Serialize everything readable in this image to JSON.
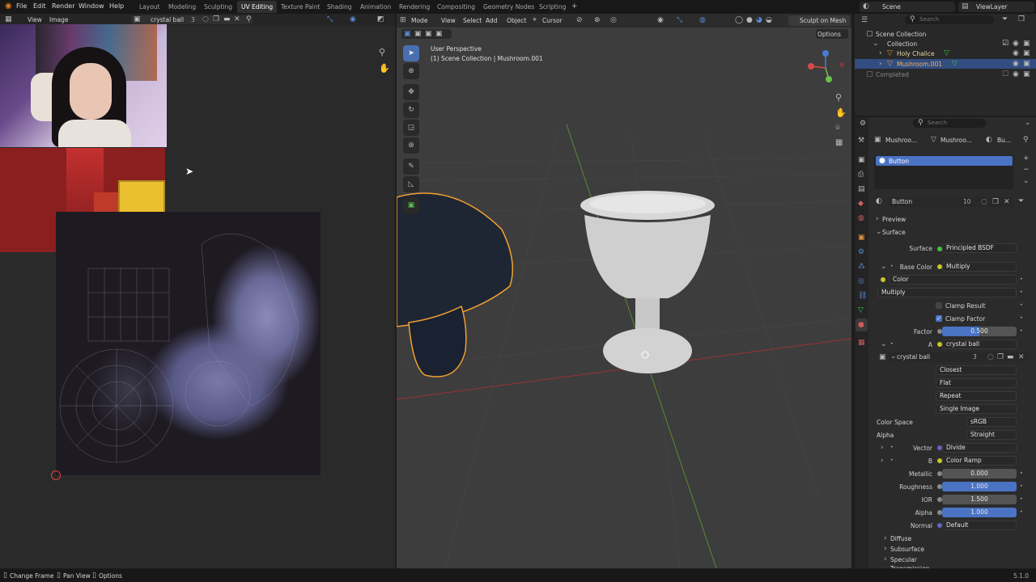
{
  "menubar": {
    "items": [
      "File",
      "Edit",
      "Render",
      "Window",
      "Help"
    ],
    "workspaces": [
      "Layout",
      "Modeling",
      "Sculpting",
      "UV Editing",
      "Texture Paint",
      "Shading",
      "Animation",
      "Rendering",
      "Compositing",
      "Geometry Nodes",
      "Scripting"
    ],
    "active_workspace": "UV Editing",
    "scene": "Scene",
    "view_layer": "ViewLayer"
  },
  "uv_editor": {
    "menu": [
      "View",
      "Image"
    ],
    "image_name": "crystal ball",
    "image_users": "3"
  },
  "viewport": {
    "mode": "Mode",
    "menus": [
      "View",
      "Select",
      "Add",
      "Object"
    ],
    "transform_orient": "Cursor",
    "sculpt_btn": "Sculpt on Mesh",
    "options": "Options",
    "view_name": "User Perspective",
    "collection_path": "(1) Scene Collection | Mushroom.001"
  },
  "outliner": {
    "search_placeholder": "Search",
    "root": "Scene Collection",
    "collection": "Collection",
    "items": [
      "Holy Chalice",
      "Mushroom.001"
    ],
    "completed": "Completed"
  },
  "properties": {
    "search_placeholder": "Search",
    "breadcrumb": [
      "Mushroo...",
      "Mushroo...",
      "Bu..."
    ],
    "material_slot": "Button",
    "material_name": "Button",
    "material_users": "10",
    "sections": {
      "preview": "Preview",
      "surface": "Surface",
      "diffuse": "Diffuse",
      "subsurface": "Subsurface",
      "specular": "Specular",
      "transmission": "Transmission"
    },
    "surface_label": "Surface",
    "surface_value": "Principled BSDF",
    "base_color_label": "Base Color",
    "base_color_value": "Multiply",
    "color_label": "Color",
    "blend_mode": "Multiply",
    "clamp_result": "Clamp Result",
    "clamp_factor": "Clamp Factor",
    "factor_label": "Factor",
    "factor_value": "0.500",
    "a_label": "A",
    "a_value": "crystal ball",
    "image_name": "crystal ball",
    "image_users": "3",
    "interp": "Closest",
    "projection": "Flat",
    "extension": "Repeat",
    "source": "Single Image",
    "color_space_label": "Color Space",
    "color_space_value": "sRGB",
    "alpha_label": "Alpha",
    "alpha_mode": "Straight",
    "vector_label": "Vector",
    "vector_value": "Divide",
    "b_label": "B",
    "b_value": "Color Ramp",
    "metallic_label": "Metallic",
    "metallic_value": "0.000",
    "metallic_level": 0.0,
    "roughness_label": "Roughness",
    "roughness_value": "1.000",
    "roughness_level": 1.0,
    "ior_label": "IOR",
    "ior_value": "1.500",
    "alpha2_label": "Alpha",
    "alpha2_value": "1.000",
    "alpha2_level": 1.0,
    "normal_label": "Normal",
    "normal_value": "Default"
  },
  "statusbar": {
    "items": [
      "Change Frame",
      "Pan View",
      "Options"
    ],
    "version": "5.1.0"
  },
  "colors": {
    "accent": "#4b73c4",
    "selection_orange": "#f0a030",
    "socket_yellow": "#c7c729",
    "socket_purple": "#6363c7",
    "socket_green": "#3fc43f"
  }
}
